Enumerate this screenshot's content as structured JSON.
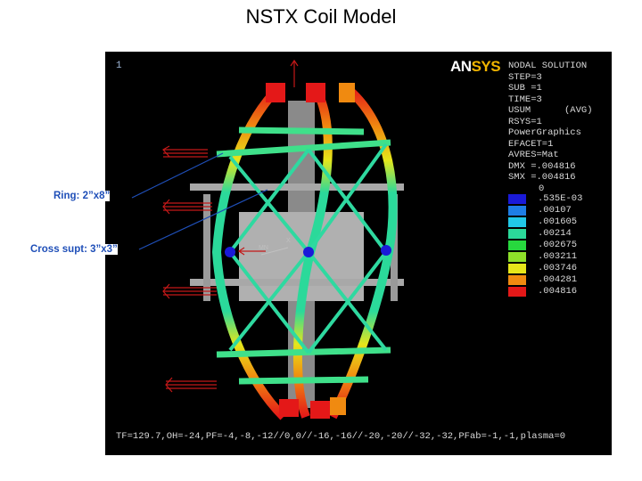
{
  "title": "NSTX Coil Model",
  "viewport": {
    "window_number": "1",
    "logo": {
      "part1": "AN",
      "part2": "SYS"
    },
    "info_lines": [
      "NODAL SOLUTION",
      "STEP=3",
      "SUB =1",
      "TIME=3",
      "USUM      (AVG)",
      "RSYS=1",
      "PowerGraphics",
      "EFACET=1",
      "AVRES=Mat",
      "DMX =.004816",
      "SMX =.004816"
    ],
    "legend": {
      "zero": "0",
      "entries": [
        {
          "value": ".535E-03",
          "color": "#1a1ad8"
        },
        {
          "value": ".00107",
          "color": "#1e7ee6"
        },
        {
          "value": ".001605",
          "color": "#21c8e8"
        },
        {
          "value": ".00214",
          "color": "#2bd99a"
        },
        {
          "value": ".002675",
          "color": "#27d83e"
        },
        {
          "value": ".003211",
          "color": "#8ee02a"
        },
        {
          "value": ".003746",
          "color": "#e6e61a"
        },
        {
          "value": ".004281",
          "color": "#f08a10"
        },
        {
          "value": ".004816",
          "color": "#e41818"
        }
      ]
    },
    "footer": "TF=129.7,OH=-24,PF=-4,-8,-12//0,0//-16,-16//-20,-20//-32,-32,PFab=-1,-1,plasma=0",
    "triad_labels": {
      "mn": "MN",
      "x": "X"
    }
  },
  "callouts": {
    "ring": "Ring: 2”x8”",
    "cross": "Cross supt: 3”x3”"
  },
  "colors": {
    "frame_green": "#2fd9a0",
    "ring_green": "#3fe08a",
    "hot_red": "#e41818",
    "center_gray": "#9a9a9a",
    "arrow_red": "#c41818",
    "callout_blue": "#1f4fb8"
  }
}
